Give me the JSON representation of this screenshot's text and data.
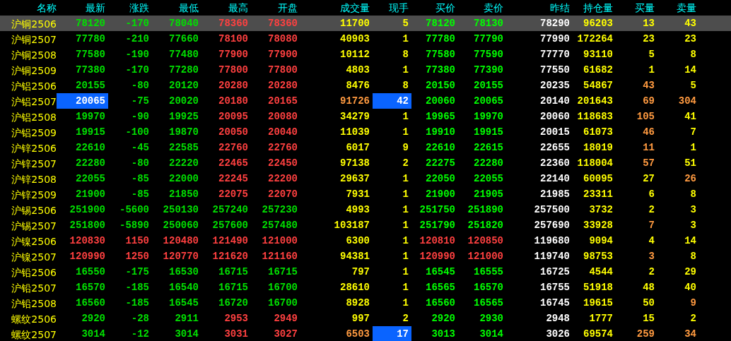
{
  "table": {
    "columns": [
      "名称",
      "最新",
      "涨跌",
      "最低",
      "最高",
      "开盘",
      "成交量",
      "现手",
      "买价",
      "卖价",
      "昨结",
      "持仓量",
      "买量",
      "卖量"
    ],
    "rows": [
      {
        "selected": true,
        "cells": [
          {
            "text": "沪铜2506",
            "color": "#ffff00",
            "highlighted": false
          },
          {
            "text": "78120",
            "color": "#00e000",
            "highlighted": false
          },
          {
            "text": "-170",
            "color": "#00e000",
            "highlighted": false
          },
          {
            "text": "78040",
            "color": "#00e000",
            "highlighted": false
          },
          {
            "text": "78360",
            "color": "#ff4040",
            "highlighted": false
          },
          {
            "text": "78360",
            "color": "#ff4040",
            "highlighted": false
          },
          {
            "text": "11700",
            "color": "#ffff00",
            "highlighted": false
          },
          {
            "text": "5",
            "color": "#ffff00",
            "highlighted": false
          },
          {
            "text": "78120",
            "color": "#00ff00",
            "highlighted": false
          },
          {
            "text": "78130",
            "color": "#00ff00",
            "highlighted": false
          },
          {
            "text": "78290",
            "color": "#ffffff",
            "highlighted": false
          },
          {
            "text": "96203",
            "color": "#ffff00",
            "highlighted": false
          },
          {
            "text": "13",
            "color": "#ffff00",
            "highlighted": false
          },
          {
            "text": "43",
            "color": "#ffff00",
            "highlighted": false
          }
        ]
      },
      {
        "selected": false,
        "cells": [
          {
            "text": "沪铜2507",
            "color": "#ffff00",
            "highlighted": false
          },
          {
            "text": "77780",
            "color": "#00e000",
            "highlighted": false
          },
          {
            "text": "-210",
            "color": "#00e000",
            "highlighted": false
          },
          {
            "text": "77660",
            "color": "#00e000",
            "highlighted": false
          },
          {
            "text": "78100",
            "color": "#ff4040",
            "highlighted": false
          },
          {
            "text": "78080",
            "color": "#ff4040",
            "highlighted": false
          },
          {
            "text": "40903",
            "color": "#ffff00",
            "highlighted": false
          },
          {
            "text": "1",
            "color": "#ffff00",
            "highlighted": false
          },
          {
            "text": "77780",
            "color": "#00ff00",
            "highlighted": false
          },
          {
            "text": "77790",
            "color": "#00ff00",
            "highlighted": false
          },
          {
            "text": "77990",
            "color": "#ffffff",
            "highlighted": false
          },
          {
            "text": "172264",
            "color": "#ffff00",
            "highlighted": false
          },
          {
            "text": "23",
            "color": "#ffff00",
            "highlighted": false
          },
          {
            "text": "23",
            "color": "#ffff00",
            "highlighted": false
          }
        ]
      },
      {
        "selected": false,
        "cells": [
          {
            "text": "沪铜2508",
            "color": "#ffff00",
            "highlighted": false
          },
          {
            "text": "77580",
            "color": "#00e000",
            "highlighted": false
          },
          {
            "text": "-190",
            "color": "#00e000",
            "highlighted": false
          },
          {
            "text": "77480",
            "color": "#00e000",
            "highlighted": false
          },
          {
            "text": "77900",
            "color": "#ff4040",
            "highlighted": false
          },
          {
            "text": "77900",
            "color": "#ff4040",
            "highlighted": false
          },
          {
            "text": "10112",
            "color": "#ffff00",
            "highlighted": false
          },
          {
            "text": "8",
            "color": "#ffff00",
            "highlighted": false
          },
          {
            "text": "77580",
            "color": "#00ff00",
            "highlighted": false
          },
          {
            "text": "77590",
            "color": "#00ff00",
            "highlighted": false
          },
          {
            "text": "77770",
            "color": "#ffffff",
            "highlighted": false
          },
          {
            "text": "93110",
            "color": "#ffff00",
            "highlighted": false
          },
          {
            "text": "5",
            "color": "#ffff00",
            "highlighted": false
          },
          {
            "text": "8",
            "color": "#ffff00",
            "highlighted": false
          }
        ]
      },
      {
        "selected": false,
        "cells": [
          {
            "text": "沪铜2509",
            "color": "#ffff00",
            "highlighted": false
          },
          {
            "text": "77380",
            "color": "#00e000",
            "highlighted": false
          },
          {
            "text": "-170",
            "color": "#00e000",
            "highlighted": false
          },
          {
            "text": "77280",
            "color": "#00e000",
            "highlighted": false
          },
          {
            "text": "77800",
            "color": "#ff4040",
            "highlighted": false
          },
          {
            "text": "77800",
            "color": "#ff4040",
            "highlighted": false
          },
          {
            "text": "4803",
            "color": "#ffff00",
            "highlighted": false
          },
          {
            "text": "1",
            "color": "#ffff00",
            "highlighted": false
          },
          {
            "text": "77380",
            "color": "#00ff00",
            "highlighted": false
          },
          {
            "text": "77390",
            "color": "#00ff00",
            "highlighted": false
          },
          {
            "text": "77550",
            "color": "#ffffff",
            "highlighted": false
          },
          {
            "text": "61682",
            "color": "#ffff00",
            "highlighted": false
          },
          {
            "text": "1",
            "color": "#ffff00",
            "highlighted": false
          },
          {
            "text": "14",
            "color": "#ffff00",
            "highlighted": false
          }
        ]
      },
      {
        "selected": false,
        "cells": [
          {
            "text": "沪铝2506",
            "color": "#ffff00",
            "highlighted": false
          },
          {
            "text": "20155",
            "color": "#00e000",
            "highlighted": false
          },
          {
            "text": "-80",
            "color": "#00e000",
            "highlighted": false
          },
          {
            "text": "20120",
            "color": "#00e000",
            "highlighted": false
          },
          {
            "text": "20280",
            "color": "#ff4040",
            "highlighted": false
          },
          {
            "text": "20280",
            "color": "#ff4040",
            "highlighted": false
          },
          {
            "text": "8476",
            "color": "#ffff00",
            "highlighted": false
          },
          {
            "text": "8",
            "color": "#ffff00",
            "highlighted": false
          },
          {
            "text": "20150",
            "color": "#00ff00",
            "highlighted": false
          },
          {
            "text": "20155",
            "color": "#00ff00",
            "highlighted": false
          },
          {
            "text": "20235",
            "color": "#ffffff",
            "highlighted": false
          },
          {
            "text": "54867",
            "color": "#ffff00",
            "highlighted": false
          },
          {
            "text": "43",
            "color": "#ff9a40",
            "highlighted": false
          },
          {
            "text": "5",
            "color": "#ffff00",
            "highlighted": false
          }
        ]
      },
      {
        "selected": false,
        "cells": [
          {
            "text": "沪铝2507",
            "color": "#ffff00",
            "highlighted": false
          },
          {
            "text": "20065",
            "color": "#ffffff",
            "highlighted": true
          },
          {
            "text": "-75",
            "color": "#00e000",
            "highlighted": false
          },
          {
            "text": "20020",
            "color": "#00e000",
            "highlighted": false
          },
          {
            "text": "20180",
            "color": "#ff4040",
            "highlighted": false
          },
          {
            "text": "20165",
            "color": "#ff4040",
            "highlighted": false
          },
          {
            "text": "91726",
            "color": "#ff9a40",
            "highlighted": false
          },
          {
            "text": "42",
            "color": "#ffffff",
            "highlighted": true
          },
          {
            "text": "20060",
            "color": "#00ff00",
            "highlighted": false
          },
          {
            "text": "20065",
            "color": "#00ff00",
            "highlighted": false
          },
          {
            "text": "20140",
            "color": "#ffffff",
            "highlighted": false
          },
          {
            "text": "201643",
            "color": "#ffff00",
            "highlighted": false
          },
          {
            "text": "69",
            "color": "#ff9a40",
            "highlighted": false
          },
          {
            "text": "304",
            "color": "#ff9a40",
            "highlighted": false
          }
        ]
      },
      {
        "selected": false,
        "cells": [
          {
            "text": "沪铝2508",
            "color": "#ffff00",
            "highlighted": false
          },
          {
            "text": "19970",
            "color": "#00e000",
            "highlighted": false
          },
          {
            "text": "-90",
            "color": "#00e000",
            "highlighted": false
          },
          {
            "text": "19925",
            "color": "#00e000",
            "highlighted": false
          },
          {
            "text": "20095",
            "color": "#ff4040",
            "highlighted": false
          },
          {
            "text": "20080",
            "color": "#ff4040",
            "highlighted": false
          },
          {
            "text": "34279",
            "color": "#ffff00",
            "highlighted": false
          },
          {
            "text": "1",
            "color": "#ffff00",
            "highlighted": false
          },
          {
            "text": "19965",
            "color": "#00ff00",
            "highlighted": false
          },
          {
            "text": "19970",
            "color": "#00ff00",
            "highlighted": false
          },
          {
            "text": "20060",
            "color": "#ffffff",
            "highlighted": false
          },
          {
            "text": "118683",
            "color": "#ffff00",
            "highlighted": false
          },
          {
            "text": "105",
            "color": "#ff9a40",
            "highlighted": false
          },
          {
            "text": "41",
            "color": "#ffff00",
            "highlighted": false
          }
        ]
      },
      {
        "selected": false,
        "cells": [
          {
            "text": "沪铝2509",
            "color": "#ffff00",
            "highlighted": false
          },
          {
            "text": "19915",
            "color": "#00e000",
            "highlighted": false
          },
          {
            "text": "-100",
            "color": "#00e000",
            "highlighted": false
          },
          {
            "text": "19870",
            "color": "#00e000",
            "highlighted": false
          },
          {
            "text": "20050",
            "color": "#ff4040",
            "highlighted": false
          },
          {
            "text": "20040",
            "color": "#ff4040",
            "highlighted": false
          },
          {
            "text": "11039",
            "color": "#ffff00",
            "highlighted": false
          },
          {
            "text": "1",
            "color": "#ffff00",
            "highlighted": false
          },
          {
            "text": "19910",
            "color": "#00ff00",
            "highlighted": false
          },
          {
            "text": "19915",
            "color": "#00ff00",
            "highlighted": false
          },
          {
            "text": "20015",
            "color": "#ffffff",
            "highlighted": false
          },
          {
            "text": "61073",
            "color": "#ffff00",
            "highlighted": false
          },
          {
            "text": "46",
            "color": "#ff9a40",
            "highlighted": false
          },
          {
            "text": "7",
            "color": "#ffff00",
            "highlighted": false
          }
        ]
      },
      {
        "selected": false,
        "cells": [
          {
            "text": "沪锌2506",
            "color": "#ffff00",
            "highlighted": false
          },
          {
            "text": "22610",
            "color": "#00e000",
            "highlighted": false
          },
          {
            "text": "-45",
            "color": "#00e000",
            "highlighted": false
          },
          {
            "text": "22585",
            "color": "#00e000",
            "highlighted": false
          },
          {
            "text": "22760",
            "color": "#ff4040",
            "highlighted": false
          },
          {
            "text": "22760",
            "color": "#ff4040",
            "highlighted": false
          },
          {
            "text": "6017",
            "color": "#ffff00",
            "highlighted": false
          },
          {
            "text": "9",
            "color": "#ffff00",
            "highlighted": false
          },
          {
            "text": "22610",
            "color": "#00ff00",
            "highlighted": false
          },
          {
            "text": "22615",
            "color": "#00ff00",
            "highlighted": false
          },
          {
            "text": "22655",
            "color": "#ffffff",
            "highlighted": false
          },
          {
            "text": "18019",
            "color": "#ffff00",
            "highlighted": false
          },
          {
            "text": "11",
            "color": "#ff9a40",
            "highlighted": false
          },
          {
            "text": "1",
            "color": "#ffff00",
            "highlighted": false
          }
        ]
      },
      {
        "selected": false,
        "cells": [
          {
            "text": "沪锌2507",
            "color": "#ffff00",
            "highlighted": false
          },
          {
            "text": "22280",
            "color": "#00e000",
            "highlighted": false
          },
          {
            "text": "-80",
            "color": "#00e000",
            "highlighted": false
          },
          {
            "text": "22220",
            "color": "#00e000",
            "highlighted": false
          },
          {
            "text": "22465",
            "color": "#ff4040",
            "highlighted": false
          },
          {
            "text": "22450",
            "color": "#ff4040",
            "highlighted": false
          },
          {
            "text": "97138",
            "color": "#ffff00",
            "highlighted": false
          },
          {
            "text": "2",
            "color": "#ffff00",
            "highlighted": false
          },
          {
            "text": "22275",
            "color": "#00ff00",
            "highlighted": false
          },
          {
            "text": "22280",
            "color": "#00ff00",
            "highlighted": false
          },
          {
            "text": "22360",
            "color": "#ffffff",
            "highlighted": false
          },
          {
            "text": "118004",
            "color": "#ffff00",
            "highlighted": false
          },
          {
            "text": "57",
            "color": "#ff9a40",
            "highlighted": false
          },
          {
            "text": "51",
            "color": "#ffff00",
            "highlighted": false
          }
        ]
      },
      {
        "selected": false,
        "cells": [
          {
            "text": "沪锌2508",
            "color": "#ffff00",
            "highlighted": false
          },
          {
            "text": "22055",
            "color": "#00e000",
            "highlighted": false
          },
          {
            "text": "-85",
            "color": "#00e000",
            "highlighted": false
          },
          {
            "text": "22000",
            "color": "#00e000",
            "highlighted": false
          },
          {
            "text": "22245",
            "color": "#ff4040",
            "highlighted": false
          },
          {
            "text": "22200",
            "color": "#ff4040",
            "highlighted": false
          },
          {
            "text": "29637",
            "color": "#ffff00",
            "highlighted": false
          },
          {
            "text": "1",
            "color": "#ffff00",
            "highlighted": false
          },
          {
            "text": "22050",
            "color": "#00ff00",
            "highlighted": false
          },
          {
            "text": "22055",
            "color": "#00ff00",
            "highlighted": false
          },
          {
            "text": "22140",
            "color": "#ffffff",
            "highlighted": false
          },
          {
            "text": "60095",
            "color": "#ffff00",
            "highlighted": false
          },
          {
            "text": "27",
            "color": "#ffff00",
            "highlighted": false
          },
          {
            "text": "26",
            "color": "#ff9a40",
            "highlighted": false
          }
        ]
      },
      {
        "selected": false,
        "cells": [
          {
            "text": "沪锌2509",
            "color": "#ffff00",
            "highlighted": false
          },
          {
            "text": "21900",
            "color": "#00e000",
            "highlighted": false
          },
          {
            "text": "-85",
            "color": "#00e000",
            "highlighted": false
          },
          {
            "text": "21850",
            "color": "#00e000",
            "highlighted": false
          },
          {
            "text": "22075",
            "color": "#ff4040",
            "highlighted": false
          },
          {
            "text": "22070",
            "color": "#ff4040",
            "highlighted": false
          },
          {
            "text": "7931",
            "color": "#ffff00",
            "highlighted": false
          },
          {
            "text": "1",
            "color": "#ffff00",
            "highlighted": false
          },
          {
            "text": "21900",
            "color": "#00ff00",
            "highlighted": false
          },
          {
            "text": "21905",
            "color": "#00ff00",
            "highlighted": false
          },
          {
            "text": "21985",
            "color": "#ffffff",
            "highlighted": false
          },
          {
            "text": "23311",
            "color": "#ffff00",
            "highlighted": false
          },
          {
            "text": "6",
            "color": "#ffff00",
            "highlighted": false
          },
          {
            "text": "8",
            "color": "#ffff00",
            "highlighted": false
          }
        ]
      },
      {
        "selected": false,
        "cells": [
          {
            "text": "沪锡2506",
            "color": "#ffff00",
            "highlighted": false
          },
          {
            "text": "251900",
            "color": "#00e000",
            "highlighted": false
          },
          {
            "text": "-5600",
            "color": "#00e000",
            "highlighted": false
          },
          {
            "text": "250130",
            "color": "#00e000",
            "highlighted": false
          },
          {
            "text": "257240",
            "color": "#00e000",
            "highlighted": false
          },
          {
            "text": "257230",
            "color": "#00e000",
            "highlighted": false
          },
          {
            "text": "4993",
            "color": "#ffff00",
            "highlighted": false
          },
          {
            "text": "1",
            "color": "#ffff00",
            "highlighted": false
          },
          {
            "text": "251750",
            "color": "#00ff00",
            "highlighted": false
          },
          {
            "text": "251890",
            "color": "#00ff00",
            "highlighted": false
          },
          {
            "text": "257500",
            "color": "#ffffff",
            "highlighted": false
          },
          {
            "text": "3732",
            "color": "#ffff00",
            "highlighted": false
          },
          {
            "text": "2",
            "color": "#ffff00",
            "highlighted": false
          },
          {
            "text": "3",
            "color": "#ffff00",
            "highlighted": false
          }
        ]
      },
      {
        "selected": false,
        "cells": [
          {
            "text": "沪锡2507",
            "color": "#ffff00",
            "highlighted": false
          },
          {
            "text": "251800",
            "color": "#00e000",
            "highlighted": false
          },
          {
            "text": "-5890",
            "color": "#00e000",
            "highlighted": false
          },
          {
            "text": "250060",
            "color": "#00e000",
            "highlighted": false
          },
          {
            "text": "257600",
            "color": "#00e000",
            "highlighted": false
          },
          {
            "text": "257480",
            "color": "#00e000",
            "highlighted": false
          },
          {
            "text": "103187",
            "color": "#ffff00",
            "highlighted": false
          },
          {
            "text": "1",
            "color": "#ffff00",
            "highlighted": false
          },
          {
            "text": "251790",
            "color": "#00ff00",
            "highlighted": false
          },
          {
            "text": "251820",
            "color": "#00ff00",
            "highlighted": false
          },
          {
            "text": "257690",
            "color": "#ffffff",
            "highlighted": false
          },
          {
            "text": "33928",
            "color": "#ffff00",
            "highlighted": false
          },
          {
            "text": "7",
            "color": "#ff9a40",
            "highlighted": false
          },
          {
            "text": "3",
            "color": "#ffff00",
            "highlighted": false
          }
        ]
      },
      {
        "selected": false,
        "cells": [
          {
            "text": "沪镍2506",
            "color": "#ffff00",
            "highlighted": false
          },
          {
            "text": "120830",
            "color": "#ff4040",
            "highlighted": false
          },
          {
            "text": "1150",
            "color": "#ff4040",
            "highlighted": false
          },
          {
            "text": "120480",
            "color": "#ff4040",
            "highlighted": false
          },
          {
            "text": "121490",
            "color": "#ff4040",
            "highlighted": false
          },
          {
            "text": "121000",
            "color": "#ff4040",
            "highlighted": false
          },
          {
            "text": "6300",
            "color": "#ffff00",
            "highlighted": false
          },
          {
            "text": "1",
            "color": "#ffff00",
            "highlighted": false
          },
          {
            "text": "120810",
            "color": "#ff4040",
            "highlighted": false
          },
          {
            "text": "120850",
            "color": "#ff4040",
            "highlighted": false
          },
          {
            "text": "119680",
            "color": "#ffffff",
            "highlighted": false
          },
          {
            "text": "9094",
            "color": "#ffff00",
            "highlighted": false
          },
          {
            "text": "4",
            "color": "#ffff00",
            "highlighted": false
          },
          {
            "text": "14",
            "color": "#ffff00",
            "highlighted": false
          }
        ]
      },
      {
        "selected": false,
        "cells": [
          {
            "text": "沪镍2507",
            "color": "#ffff00",
            "highlighted": false
          },
          {
            "text": "120990",
            "color": "#ff4040",
            "highlighted": false
          },
          {
            "text": "1250",
            "color": "#ff4040",
            "highlighted": false
          },
          {
            "text": "120770",
            "color": "#ff4040",
            "highlighted": false
          },
          {
            "text": "121620",
            "color": "#ff4040",
            "highlighted": false
          },
          {
            "text": "121160",
            "color": "#ff4040",
            "highlighted": false
          },
          {
            "text": "94381",
            "color": "#ffff00",
            "highlighted": false
          },
          {
            "text": "1",
            "color": "#ffff00",
            "highlighted": false
          },
          {
            "text": "120990",
            "color": "#ff4040",
            "highlighted": false
          },
          {
            "text": "121000",
            "color": "#ff4040",
            "highlighted": false
          },
          {
            "text": "119740",
            "color": "#ffffff",
            "highlighted": false
          },
          {
            "text": "98753",
            "color": "#ffff00",
            "highlighted": false
          },
          {
            "text": "3",
            "color": "#ff9a40",
            "highlighted": false
          },
          {
            "text": "8",
            "color": "#ffff00",
            "highlighted": false
          }
        ]
      },
      {
        "selected": false,
        "cells": [
          {
            "text": "沪铅2506",
            "color": "#ffff00",
            "highlighted": false
          },
          {
            "text": "16550",
            "color": "#00e000",
            "highlighted": false
          },
          {
            "text": "-175",
            "color": "#00e000",
            "highlighted": false
          },
          {
            "text": "16530",
            "color": "#00e000",
            "highlighted": false
          },
          {
            "text": "16715",
            "color": "#00e000",
            "highlighted": false
          },
          {
            "text": "16715",
            "color": "#00e000",
            "highlighted": false
          },
          {
            "text": "797",
            "color": "#ffff00",
            "highlighted": false
          },
          {
            "text": "1",
            "color": "#ffff00",
            "highlighted": false
          },
          {
            "text": "16545",
            "color": "#00ff00",
            "highlighted": false
          },
          {
            "text": "16555",
            "color": "#00ff00",
            "highlighted": false
          },
          {
            "text": "16725",
            "color": "#ffffff",
            "highlighted": false
          },
          {
            "text": "4544",
            "color": "#ffff00",
            "highlighted": false
          },
          {
            "text": "2",
            "color": "#ffff00",
            "highlighted": false
          },
          {
            "text": "29",
            "color": "#ffff00",
            "highlighted": false
          }
        ]
      },
      {
        "selected": false,
        "cells": [
          {
            "text": "沪铅2507",
            "color": "#ffff00",
            "highlighted": false
          },
          {
            "text": "16570",
            "color": "#00e000",
            "highlighted": false
          },
          {
            "text": "-185",
            "color": "#00e000",
            "highlighted": false
          },
          {
            "text": "16540",
            "color": "#00e000",
            "highlighted": false
          },
          {
            "text": "16715",
            "color": "#00e000",
            "highlighted": false
          },
          {
            "text": "16700",
            "color": "#00e000",
            "highlighted": false
          },
          {
            "text": "28610",
            "color": "#ffff00",
            "highlighted": false
          },
          {
            "text": "1",
            "color": "#ffff00",
            "highlighted": false
          },
          {
            "text": "16565",
            "color": "#00ff00",
            "highlighted": false
          },
          {
            "text": "16570",
            "color": "#00ff00",
            "highlighted": false
          },
          {
            "text": "16755",
            "color": "#ffffff",
            "highlighted": false
          },
          {
            "text": "51918",
            "color": "#ffff00",
            "highlighted": false
          },
          {
            "text": "48",
            "color": "#ffff00",
            "highlighted": false
          },
          {
            "text": "40",
            "color": "#ffff00",
            "highlighted": false
          }
        ]
      },
      {
        "selected": false,
        "cells": [
          {
            "text": "沪铅2508",
            "color": "#ffff00",
            "highlighted": false
          },
          {
            "text": "16560",
            "color": "#00e000",
            "highlighted": false
          },
          {
            "text": "-185",
            "color": "#00e000",
            "highlighted": false
          },
          {
            "text": "16545",
            "color": "#00e000",
            "highlighted": false
          },
          {
            "text": "16720",
            "color": "#00e000",
            "highlighted": false
          },
          {
            "text": "16700",
            "color": "#00e000",
            "highlighted": false
          },
          {
            "text": "8928",
            "color": "#ffff00",
            "highlighted": false
          },
          {
            "text": "1",
            "color": "#ffff00",
            "highlighted": false
          },
          {
            "text": "16560",
            "color": "#00ff00",
            "highlighted": false
          },
          {
            "text": "16565",
            "color": "#00ff00",
            "highlighted": false
          },
          {
            "text": "16745",
            "color": "#ffffff",
            "highlighted": false
          },
          {
            "text": "19615",
            "color": "#ffff00",
            "highlighted": false
          },
          {
            "text": "50",
            "color": "#ffff00",
            "highlighted": false
          },
          {
            "text": "9",
            "color": "#ff9a40",
            "highlighted": false
          }
        ]
      },
      {
        "selected": false,
        "cells": [
          {
            "text": "螺纹2506",
            "color": "#ffff00",
            "highlighted": false
          },
          {
            "text": "2920",
            "color": "#00e000",
            "highlighted": false
          },
          {
            "text": "-28",
            "color": "#00e000",
            "highlighted": false
          },
          {
            "text": "2911",
            "color": "#00e000",
            "highlighted": false
          },
          {
            "text": "2953",
            "color": "#ff4040",
            "highlighted": false
          },
          {
            "text": "2949",
            "color": "#ff4040",
            "highlighted": false
          },
          {
            "text": "997",
            "color": "#ffff00",
            "highlighted": false
          },
          {
            "text": "2",
            "color": "#ffff00",
            "highlighted": false
          },
          {
            "text": "2920",
            "color": "#00ff00",
            "highlighted": false
          },
          {
            "text": "2930",
            "color": "#00ff00",
            "highlighted": false
          },
          {
            "text": "2948",
            "color": "#ffffff",
            "highlighted": false
          },
          {
            "text": "1777",
            "color": "#ffff00",
            "highlighted": false
          },
          {
            "text": "15",
            "color": "#ffff00",
            "highlighted": false
          },
          {
            "text": "2",
            "color": "#ffff00",
            "highlighted": false
          }
        ]
      },
      {
        "selected": false,
        "cells": [
          {
            "text": "螺纹2507",
            "color": "#ffff00",
            "highlighted": false
          },
          {
            "text": "3014",
            "color": "#00e000",
            "highlighted": false
          },
          {
            "text": "-12",
            "color": "#00e000",
            "highlighted": false
          },
          {
            "text": "3014",
            "color": "#00e000",
            "highlighted": false
          },
          {
            "text": "3031",
            "color": "#ff4040",
            "highlighted": false
          },
          {
            "text": "3027",
            "color": "#ff4040",
            "highlighted": false
          },
          {
            "text": "6503",
            "color": "#ff9a40",
            "highlighted": false
          },
          {
            "text": "17",
            "color": "#ffffff",
            "highlighted": true
          },
          {
            "text": "3013",
            "color": "#00ff00",
            "highlighted": false
          },
          {
            "text": "3014",
            "color": "#00ff00",
            "highlighted": false
          },
          {
            "text": "3026",
            "color": "#ffffff",
            "highlighted": false
          },
          {
            "text": "69574",
            "color": "#ffff00",
            "highlighted": false
          },
          {
            "text": "259",
            "color": "#ff9a40",
            "highlighted": false
          },
          {
            "text": "34",
            "color": "#ff9a40",
            "highlighted": false
          }
        ]
      }
    ]
  }
}
